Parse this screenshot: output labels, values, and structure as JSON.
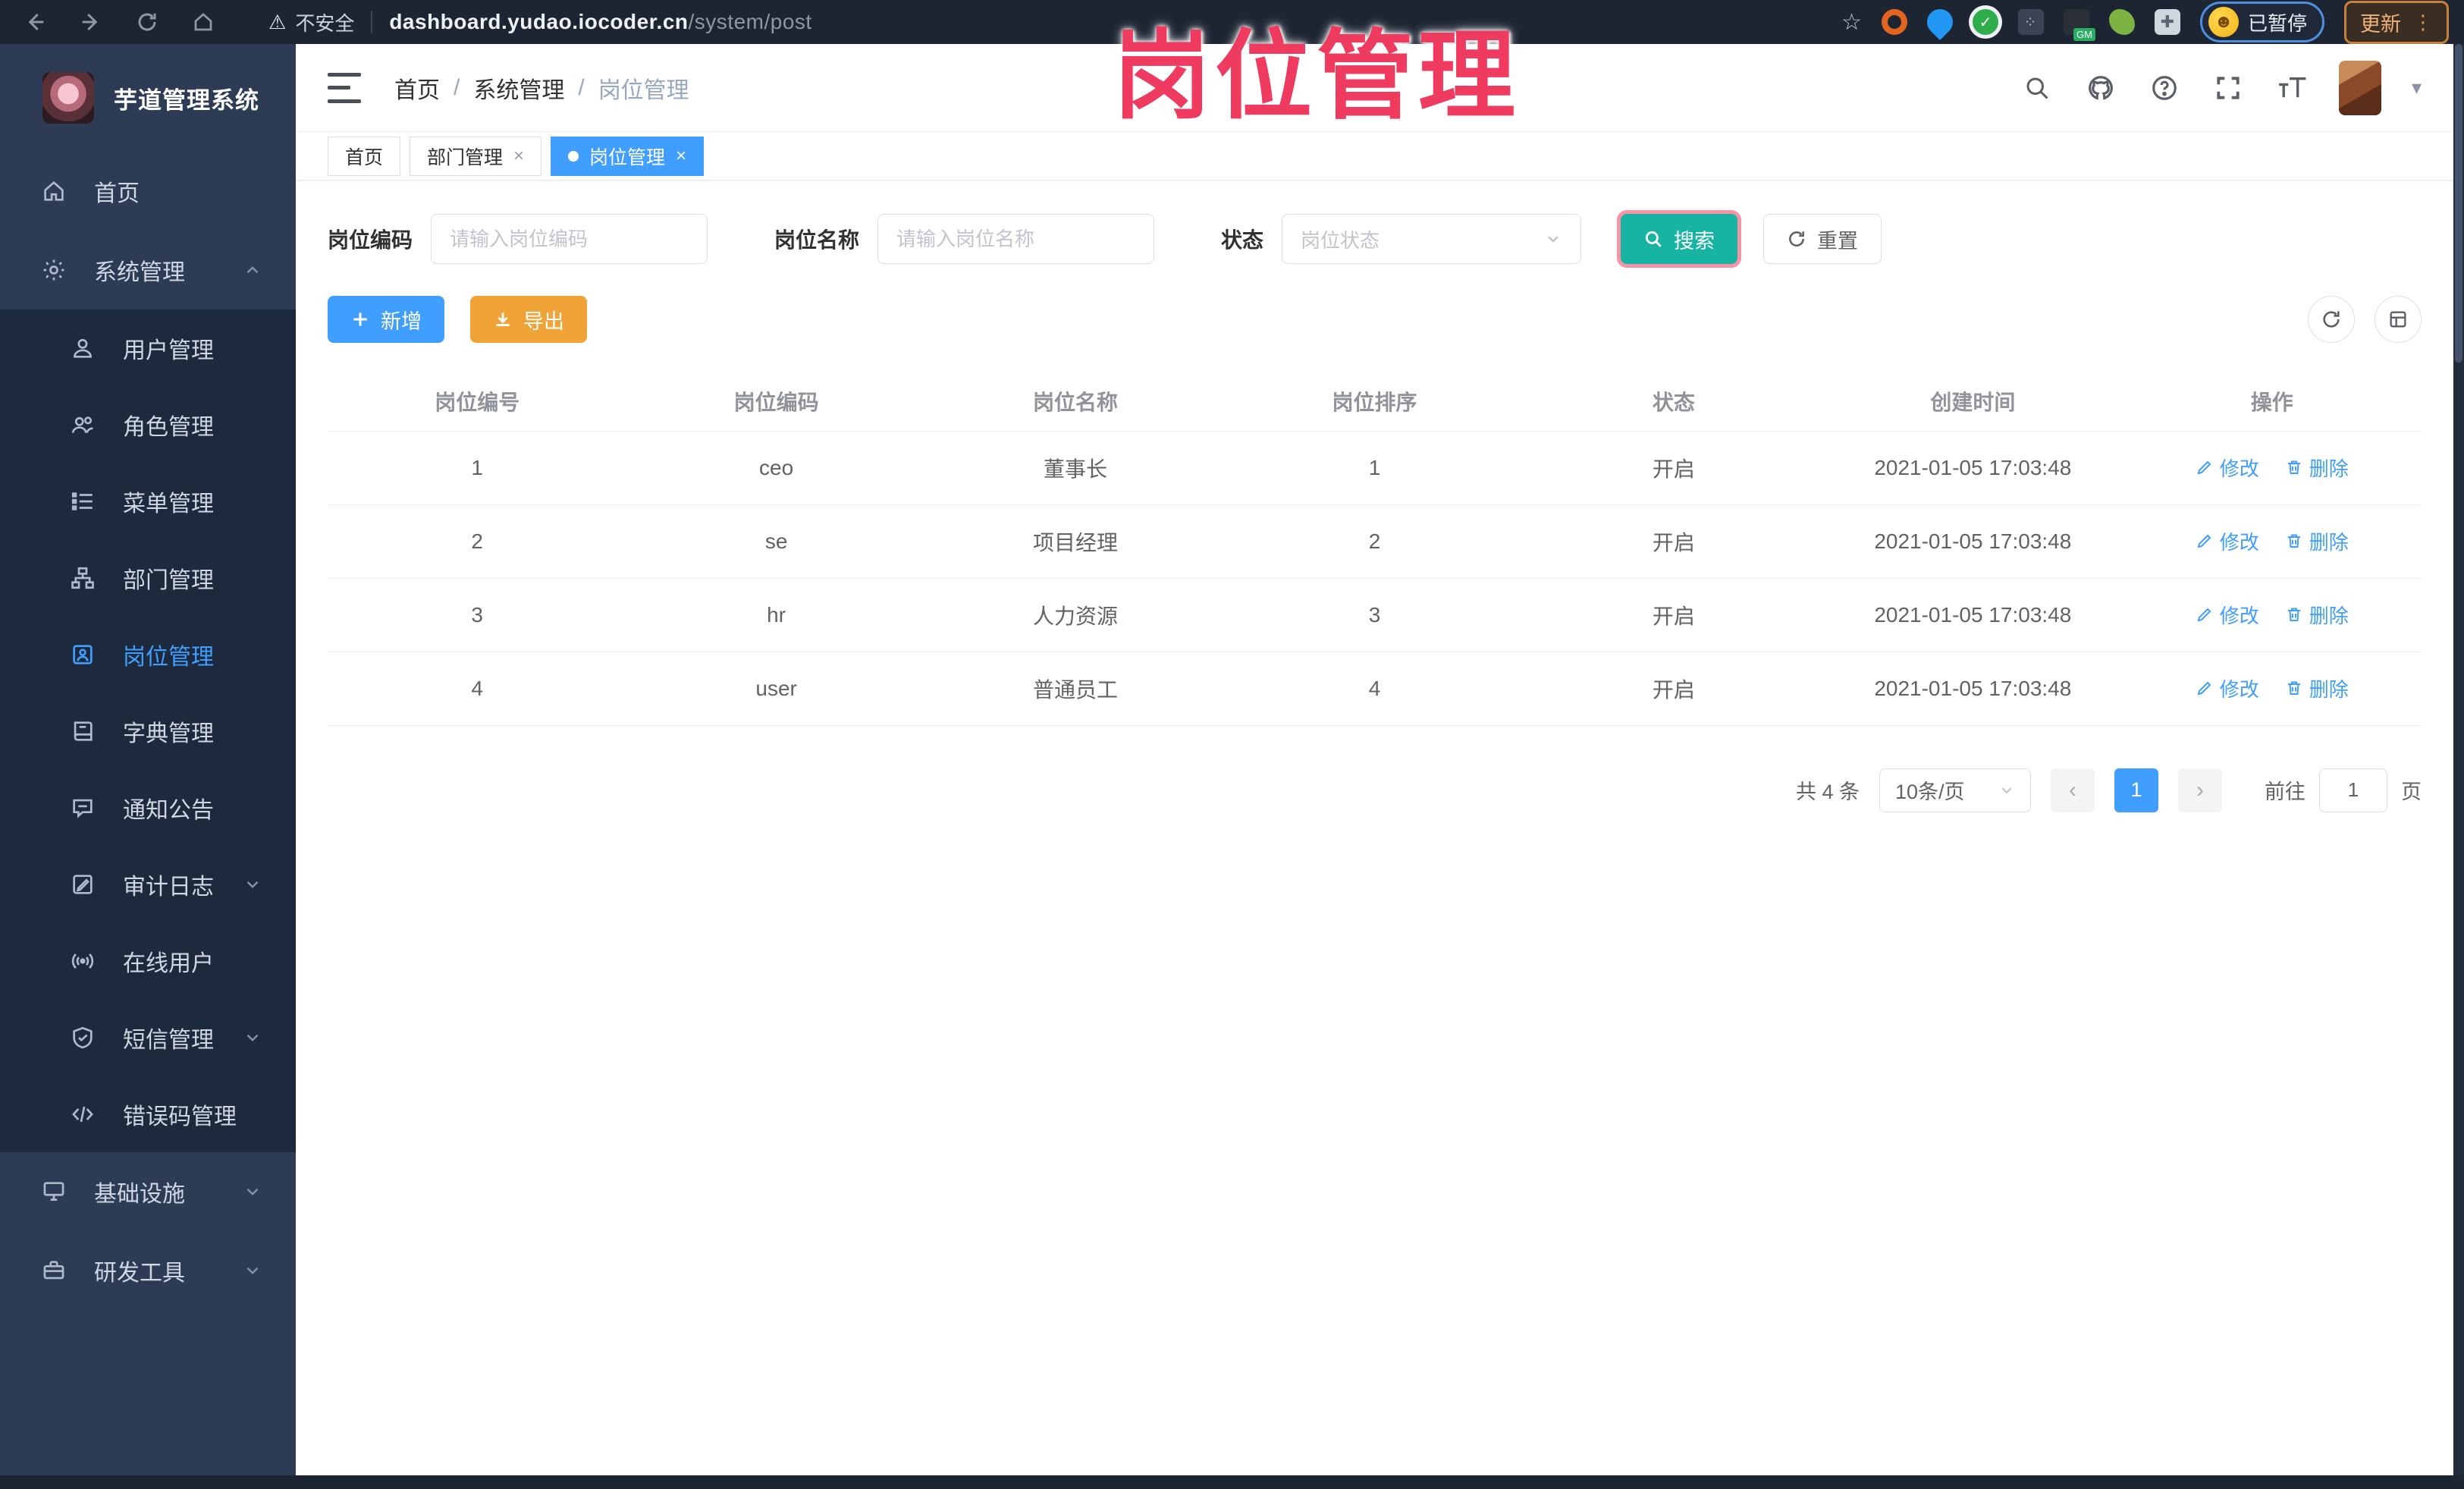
{
  "colors": {
    "accent": "#409eff",
    "search_button": "#17b3a3",
    "export_button": "#f0a337",
    "annotation": "#ee3b5f"
  },
  "browser": {
    "security_label": "不安全",
    "url_host": "dashboard.yudao.iocoder.cn",
    "url_path": "/system/post",
    "paused_badge": "已暂停",
    "update_button": "更新"
  },
  "annotation": {
    "text": "岗位管理"
  },
  "sidebar": {
    "logo_title": "芋道管理系统",
    "items": [
      {
        "label": "首页",
        "icon": "home",
        "level": 1,
        "chevron": null,
        "active": false
      },
      {
        "label": "系统管理",
        "icon": "gear",
        "level": 1,
        "chevron": "up",
        "active": false
      },
      {
        "label": "用户管理",
        "icon": "user",
        "level": 2,
        "chevron": null,
        "active": false
      },
      {
        "label": "角色管理",
        "icon": "users",
        "level": 2,
        "chevron": null,
        "active": false
      },
      {
        "label": "菜单管理",
        "icon": "list",
        "level": 2,
        "chevron": null,
        "active": false
      },
      {
        "label": "部门管理",
        "icon": "sitemap",
        "level": 2,
        "chevron": null,
        "active": false
      },
      {
        "label": "岗位管理",
        "icon": "badge",
        "level": 2,
        "chevron": null,
        "active": true
      },
      {
        "label": "字典管理",
        "icon": "book",
        "level": 2,
        "chevron": null,
        "active": false
      },
      {
        "label": "通知公告",
        "icon": "chat",
        "level": 2,
        "chevron": null,
        "active": false
      },
      {
        "label": "审计日志",
        "icon": "editlog",
        "level": 2,
        "chevron": "down",
        "active": false
      },
      {
        "label": "在线用户",
        "icon": "online",
        "level": 2,
        "chevron": null,
        "active": false
      },
      {
        "label": "短信管理",
        "icon": "shield",
        "level": 2,
        "chevron": "down",
        "active": false
      },
      {
        "label": "错误码管理",
        "icon": "code",
        "level": 2,
        "chevron": null,
        "active": false
      },
      {
        "label": "基础设施",
        "icon": "infra",
        "level": 1,
        "chevron": "down",
        "active": false
      },
      {
        "label": "研发工具",
        "icon": "tools",
        "level": 1,
        "chevron": "down",
        "active": false
      }
    ]
  },
  "breadcrumb": {
    "items": [
      "首页",
      "系统管理",
      "岗位管理"
    ]
  },
  "tabs": [
    {
      "label": "首页",
      "closable": false,
      "active": false
    },
    {
      "label": "部门管理",
      "closable": true,
      "active": false
    },
    {
      "label": "岗位管理",
      "closable": true,
      "active": true
    }
  ],
  "filters": {
    "code_label": "岗位编码",
    "code_placeholder": "请输入岗位编码",
    "name_label": "岗位名称",
    "name_placeholder": "请输入岗位名称",
    "status_label": "状态",
    "status_placeholder": "岗位状态",
    "search_label": "搜索",
    "reset_label": "重置"
  },
  "toolbar": {
    "add_label": "新增",
    "export_label": "导出"
  },
  "table": {
    "headers": [
      "岗位编号",
      "岗位编码",
      "岗位名称",
      "岗位排序",
      "状态",
      "创建时间",
      "操作"
    ],
    "edit_label": "修改",
    "delete_label": "删除",
    "rows": [
      {
        "id": "1",
        "code": "ceo",
        "name": "董事长",
        "sort": "1",
        "status": "开启",
        "created": "2021-01-05 17:03:48"
      },
      {
        "id": "2",
        "code": "se",
        "name": "项目经理",
        "sort": "2",
        "status": "开启",
        "created": "2021-01-05 17:03:48"
      },
      {
        "id": "3",
        "code": "hr",
        "name": "人力资源",
        "sort": "3",
        "status": "开启",
        "created": "2021-01-05 17:03:48"
      },
      {
        "id": "4",
        "code": "user",
        "name": "普通员工",
        "sort": "4",
        "status": "开启",
        "created": "2021-01-05 17:03:48"
      }
    ]
  },
  "pagination": {
    "total_text": "共 4 条",
    "page_size": "10条/页",
    "prev": "‹",
    "next": "›",
    "current_page": "1",
    "goto_label": "前往",
    "goto_value": "1",
    "page_suffix": "页"
  }
}
